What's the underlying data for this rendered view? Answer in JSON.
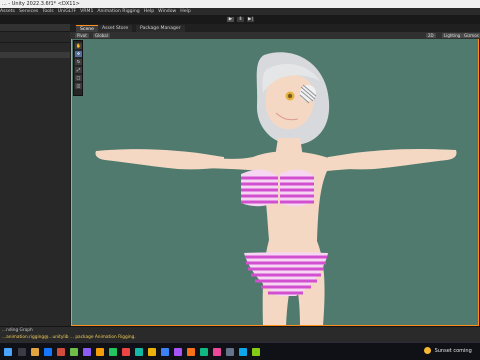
{
  "titlebar": {
    "title": "... - Unity 2022.3.6f1* <DX11>"
  },
  "menu": {
    "items": [
      "Assets",
      "Services",
      "Tools",
      "UniGLTF",
      "VRM1",
      "Animation Rigging",
      "Help",
      "Window",
      "Help"
    ]
  },
  "toolbar": {
    "play_icon": "play-icon",
    "pause_icon": "pause-icon",
    "step_icon": "step-icon"
  },
  "tabs": {
    "scene": "Scene",
    "asset_store": "Asset Store",
    "package_manager": "Package Manager"
  },
  "scene_toolbar": {
    "pivot": "Pivot",
    "global": "Global",
    "view_2d": "2D",
    "lighting": "Lighting",
    "gizmos": "Gizmos"
  },
  "status": {
    "top": "...nding Graph",
    "warning": "...animation.rigging@...unitylib ... package Animation Rigging."
  },
  "taskbar": {
    "weather": "Sunset coming"
  },
  "colors": {
    "viewport_bg": "#507a6d",
    "accent": "#ff8f1a",
    "hair": "#d8d9dc",
    "skin": "#f5d8c4",
    "stripe_pink": "#d24fd0",
    "stripe_white": "#f6d6f3"
  }
}
